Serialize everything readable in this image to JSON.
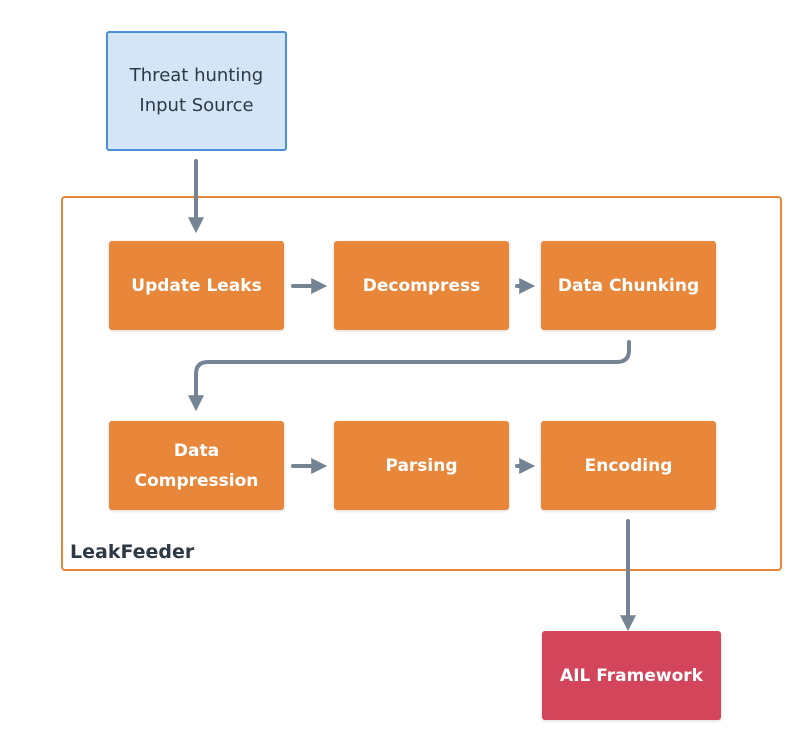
{
  "colors": {
    "input_fill": "#d3e5f6",
    "input_border": "#4a90d9",
    "step": "#e8863a",
    "output": "#d3455b",
    "arrow": "#748494",
    "container": "#e8863a"
  },
  "input": {
    "label": "Threat hunting\nInput Source"
  },
  "container": {
    "label": "LeakFeeder"
  },
  "steps": [
    {
      "label": "Update Leaks"
    },
    {
      "label": "Decompress"
    },
    {
      "label": "Data Chunking"
    },
    {
      "label": "Data\nCompression"
    },
    {
      "label": "Parsing"
    },
    {
      "label": "Encoding"
    }
  ],
  "output": {
    "label": "AIL Framework"
  }
}
